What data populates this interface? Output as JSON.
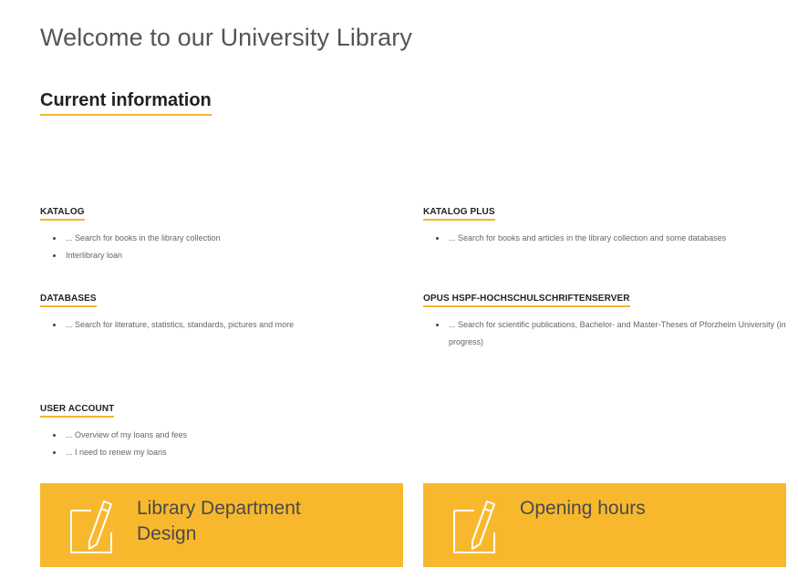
{
  "page": {
    "title": "Welcome to our University Library"
  },
  "current_info": {
    "heading": "Current information"
  },
  "blocks": {
    "katalog": {
      "title": "KATALOG",
      "items": [
        "... Search for books in the library collection",
        "Interlibrary loan"
      ]
    },
    "katalog_plus": {
      "title": "KATALOG PLUS",
      "items": [
        "... Search for books and articles in the library collection and some databases"
      ]
    },
    "databases": {
      "title": "DATABASES",
      "items": [
        "... Search for literature, statistics, standards, pictures and more"
      ]
    },
    "opus": {
      "title": "OPUS HSPF-HOCHSCHULSCHRIFTENSERVER",
      "items": [
        "... Search for scientific publications, Bachelor- and Master-Theses of Pforzheim University (in progress)"
      ]
    },
    "user_account": {
      "title": "USER ACCOUNT",
      "items": [
        "... Overview of my loans and fees",
        "... I need to renew my loans"
      ]
    }
  },
  "tiles": {
    "library_department_design": {
      "label_line1": "Library Department",
      "label_line2": "Design",
      "icon": "edit-note-icon"
    },
    "opening_hours": {
      "label_line1": "Opening hours",
      "icon": "edit-note-icon"
    }
  },
  "colors": {
    "accent": "#f8b82e",
    "underline": "#f5b52e"
  }
}
